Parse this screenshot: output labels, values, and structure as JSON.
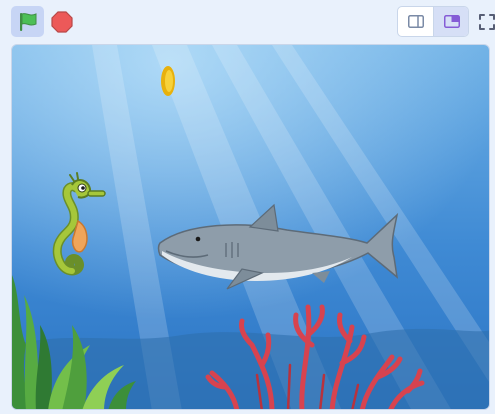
{
  "toolbar": {
    "green_flag": {
      "icon": "green-flag-icon",
      "color": "#4cbf56",
      "active": true
    },
    "stop": {
      "icon": "stop-sign-icon",
      "color": "#ec5959"
    },
    "stage_modes": [
      {
        "icon": "small-stage-icon",
        "selected": false
      },
      {
        "icon": "large-stage-icon",
        "selected": true
      }
    ],
    "fullscreen": {
      "icon": "fullscreen-icon"
    }
  },
  "colors": {
    "toolbar_bg": "#e9f1fc",
    "accent": "#855cd6",
    "selected_bg": "#d6dff6",
    "water_top": "#6fb1e6",
    "water_bottom": "#2b74c4"
  },
  "stage": {
    "sprites": [
      {
        "name": "coin",
        "icon": "gold-coin"
      },
      {
        "name": "seahorse",
        "icon": "seahorse"
      },
      {
        "name": "shark",
        "icon": "shark"
      },
      {
        "name": "coral",
        "icon": "red-coral"
      },
      {
        "name": "seaweed",
        "icon": "green-seaweed"
      }
    ]
  }
}
